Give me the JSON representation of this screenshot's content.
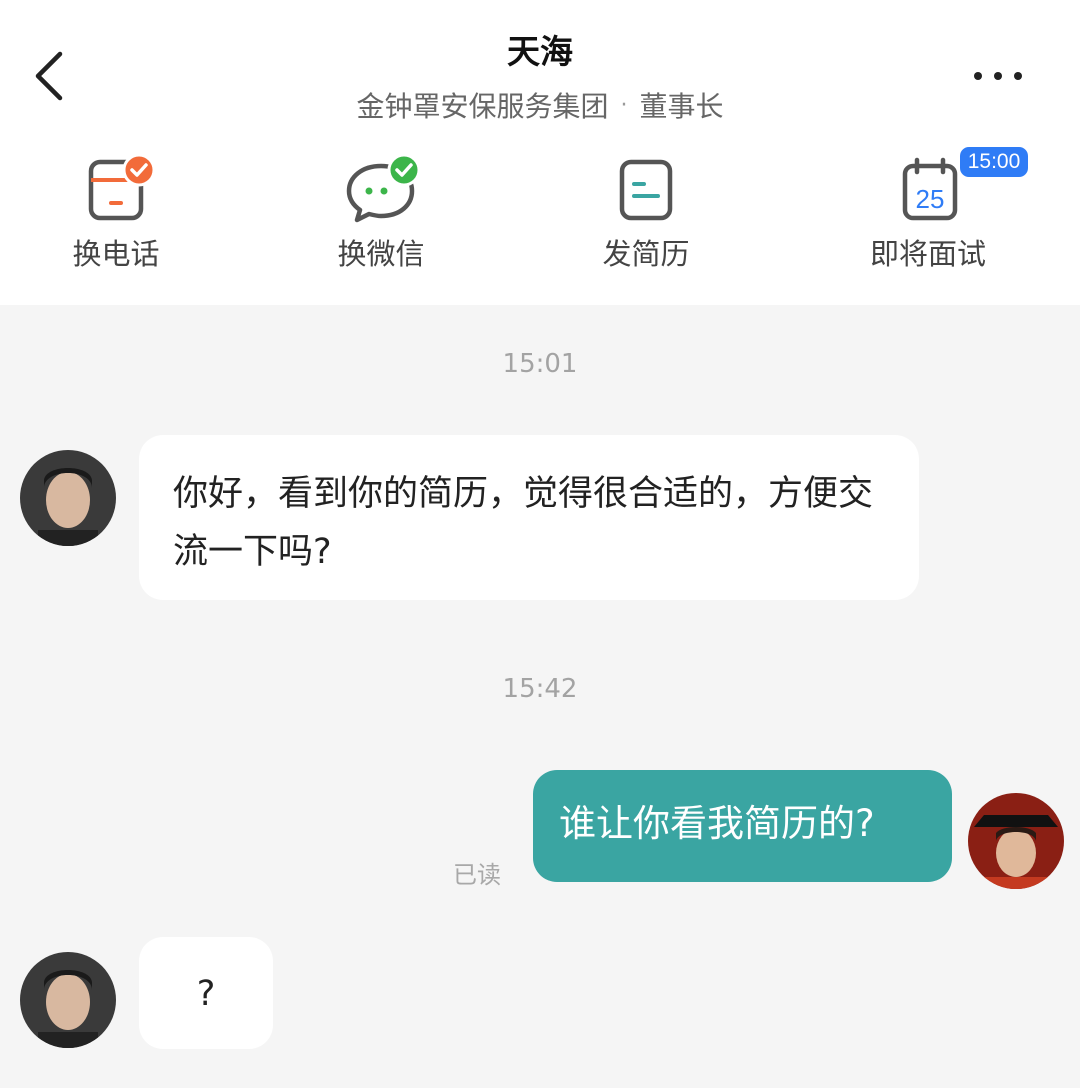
{
  "header": {
    "title": "天海",
    "company": "金钟罩安保服务集团",
    "separator": "·",
    "position": "董事长"
  },
  "actions": [
    {
      "label": "换电话",
      "icon": "phone-swap-icon",
      "badge_color": "#f26b3a"
    },
    {
      "label": "换微信",
      "icon": "wechat-swap-icon",
      "badge_color": "#3cb54a"
    },
    {
      "label": "发简历",
      "icon": "resume-icon"
    },
    {
      "label": "即将面试",
      "icon": "calendar-icon",
      "calendar_day": "25",
      "badge_time": "15:00",
      "badge_color": "#2f7cf6"
    }
  ],
  "chat": {
    "time_1": "15:01",
    "msg_1": "你好，看到你的简历，觉得很合适的，方便交流一下吗?",
    "time_2": "15:42",
    "msg_2": "谁让你看我简历的?",
    "read_status": "已读",
    "msg_3": "?"
  },
  "colors": {
    "outgoing_bubble": "#3aa5a2",
    "incoming_bubble": "#ffffff",
    "background": "#f5f5f5"
  }
}
